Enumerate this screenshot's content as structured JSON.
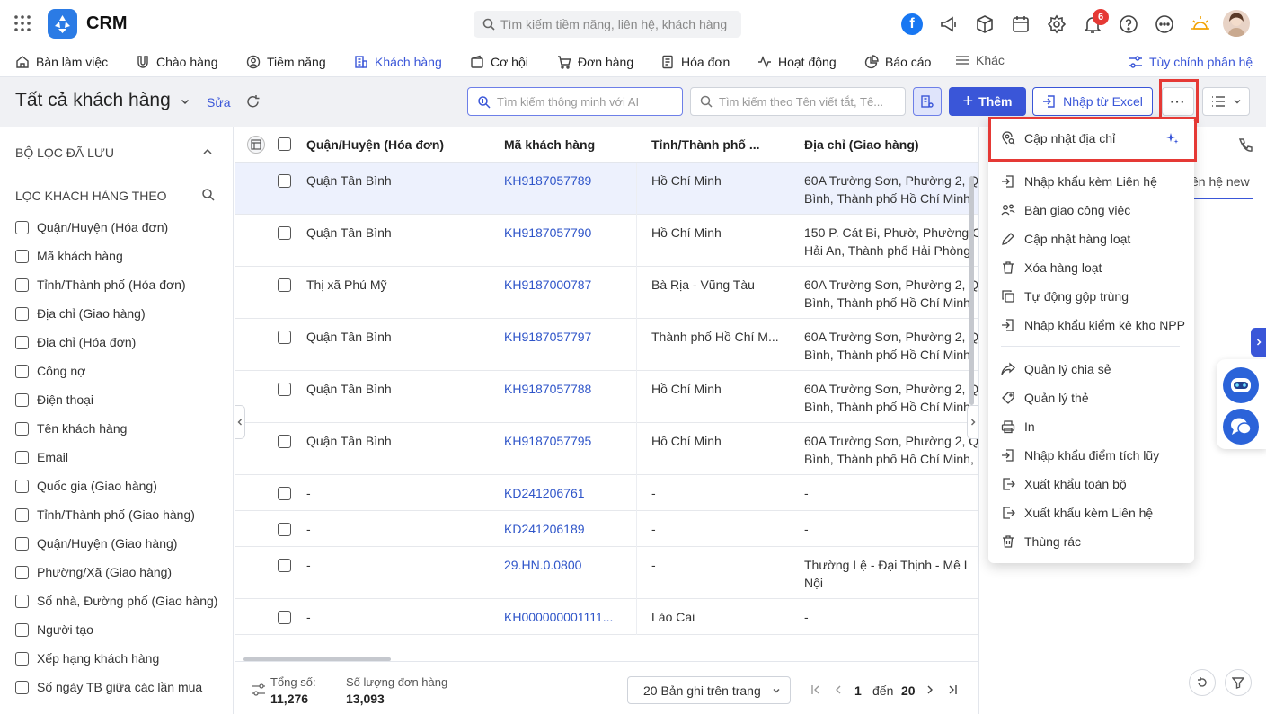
{
  "app": {
    "name": "CRM"
  },
  "search": {
    "placeholder": "Tìm kiếm tiềm năng, liên hệ, khách hàng"
  },
  "notifications": {
    "count": "6"
  },
  "nav": {
    "items": [
      {
        "label": "Bàn làm việc"
      },
      {
        "label": "Chào hàng"
      },
      {
        "label": "Tiềm năng"
      },
      {
        "label": "Khách hàng"
      },
      {
        "label": "Cơ hội"
      },
      {
        "label": "Đơn hàng"
      },
      {
        "label": "Hóa đơn"
      },
      {
        "label": "Hoạt động"
      },
      {
        "label": "Báo cáo"
      },
      {
        "label": "Khác"
      }
    ],
    "customize": "Tùy chỉnh phân hệ"
  },
  "toolbar": {
    "title": "Tất cả khách hàng",
    "edit": "Sửa",
    "ai_search_placeholder": "Tìm kiếm thông minh với AI",
    "search_placeholder": "Tìm kiếm theo Tên viết tắt, Tê...",
    "add": "Thêm",
    "import_excel": "Nhập từ Excel",
    "more": "···"
  },
  "sidebar": {
    "saved_filters": "BỘ LỌC ĐÃ LƯU",
    "filter_by": "LỌC KHÁCH HÀNG THEO",
    "filters": [
      "Quận/Huyện (Hóa đơn)",
      "Mã khách hàng",
      "Tỉnh/Thành phố (Hóa đơn)",
      "Địa chỉ (Giao hàng)",
      "Địa chỉ (Hóa đơn)",
      "Công nợ",
      "Điện thoại",
      "Tên khách hàng",
      "Email",
      "Quốc gia (Giao hàng)",
      "Tỉnh/Thành phố (Giao hàng)",
      "Quận/Huyện (Giao hàng)",
      "Phường/Xã (Giao hàng)",
      "Số nhà, Đường phố (Giao hàng)",
      "Người tạo",
      "Xếp hạng khách hàng",
      "Số ngày TB giữa các lần mua"
    ]
  },
  "table": {
    "columns": [
      "Quận/Huyện (Hóa đơn)",
      "Mã khách hàng",
      "Tỉnh/Thành phố ...",
      "Địa chỉ (Giao hàng)"
    ],
    "rows": [
      {
        "district": "Quận Tân Bình",
        "code": "KH9187057789",
        "province": "Hồ Chí Minh",
        "addr1": "60A Trường Sơn, Phường 2, Q",
        "addr2": "Bình, Thành phố Hồ Chí Minh,"
      },
      {
        "district": "Quận Tân Bình",
        "code": "KH9187057790",
        "province": "Hồ Chí Minh",
        "addr1": "150 P. Cát Bi, Phườ, Phường C",
        "addr2": "Hải An, Thành phố Hải Phòng,"
      },
      {
        "district": "Thị xã Phú Mỹ",
        "code": "KH9187000787",
        "province": "Bà Rịa - Vũng Tàu",
        "addr1": "60A Trường Sơn, Phường 2, Q",
        "addr2": "Bình, Thành phố Hồ Chí Minh,"
      },
      {
        "district": "Quận Tân Bình",
        "code": "KH9187057797",
        "province": "Thành phố Hồ Chí M...",
        "addr1": "60A Trường Sơn, Phường 2, Q",
        "addr2": "Bình, Thành phố Hồ Chí Minh,"
      },
      {
        "district": "Quận Tân Bình",
        "code": "KH9187057788",
        "province": "Hồ Chí Minh",
        "addr1": "60A Trường Sơn, Phường 2, Q",
        "addr2": "Bình, Thành phố Hồ Chí Minh,"
      },
      {
        "district": "Quận Tân Bình",
        "code": "KH9187057795",
        "province": "Hồ Chí Minh",
        "addr1": "60A Trường Sơn, Phường 2, Q",
        "addr2": "Bình, Thành phố Hồ Chí Minh,"
      },
      {
        "district": "-",
        "code": "KD241206761",
        "province": "-",
        "addr1": "-",
        "addr2": ""
      },
      {
        "district": "-",
        "code": "KD241206189",
        "province": "-",
        "addr1": "-",
        "addr2": ""
      },
      {
        "district": "-",
        "code": "29.HN.0.0800",
        "province": "-",
        "addr1": "Thường Lệ - Đại Thịnh - Mê L",
        "addr2": "Nội"
      },
      {
        "district": "-",
        "code": "KH000000001111...",
        "province": "Lào Cai",
        "addr1": "-",
        "addr2": ""
      }
    ]
  },
  "footer": {
    "total_label": "Tổng số:",
    "total_value": "11,276",
    "orders_label": "Số lượng đơn hàng",
    "orders_value": "13,093",
    "page_size": "20 Bản ghi trên trang",
    "page_from": "1",
    "page_to_label": "đến",
    "page_to": "20"
  },
  "right_panel": {
    "partial_text": "ên hệ new"
  },
  "menu": {
    "items": [
      "Cập nhật địa chỉ",
      "Nhập khẩu kèm Liên hệ",
      "Bàn giao công việc",
      "Cập nhật hàng loạt",
      "Xóa hàng loạt",
      "Tự động gộp trùng",
      "Nhập khẩu kiểm kê kho NPP",
      "Quản lý chia sẻ",
      "Quản lý thẻ",
      "In",
      "Nhập khẩu điểm tích lũy",
      "Xuất khẩu toàn bộ",
      "Xuất khẩu kèm Liên hệ",
      "Thùng rác"
    ]
  },
  "colors": {
    "accent": "#3a56d8",
    "highlight": "#e53935",
    "selected_row": "#edf1fd"
  }
}
